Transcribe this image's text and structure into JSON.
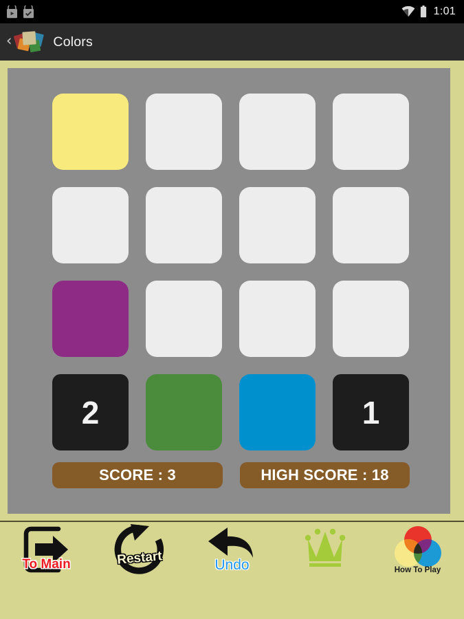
{
  "statusbar": {
    "time": "1:01",
    "icons": [
      "playstore-download-icon",
      "playstore-installed-icon",
      "wifi-icon",
      "battery-icon"
    ]
  },
  "actionbar": {
    "back_glyph": "‹",
    "title": "Colors",
    "logo_name": "colors-app-logo"
  },
  "board": {
    "background_color": "#8c8c8c",
    "page_background_color": "#d6d691",
    "empty_tile_color": "#ededed",
    "grid": [
      [
        {
          "state": "color",
          "color": "#f8ea7c",
          "label": ""
        },
        {
          "state": "empty",
          "color": "#ededed",
          "label": ""
        },
        {
          "state": "empty",
          "color": "#ededed",
          "label": ""
        },
        {
          "state": "empty",
          "color": "#ededed",
          "label": ""
        }
      ],
      [
        {
          "state": "empty",
          "color": "#ededed",
          "label": ""
        },
        {
          "state": "empty",
          "color": "#ededed",
          "label": ""
        },
        {
          "state": "empty",
          "color": "#ededed",
          "label": ""
        },
        {
          "state": "empty",
          "color": "#ededed",
          "label": ""
        }
      ],
      [
        {
          "state": "color",
          "color": "#8e2b84",
          "label": ""
        },
        {
          "state": "empty",
          "color": "#ededed",
          "label": ""
        },
        {
          "state": "empty",
          "color": "#ededed",
          "label": ""
        },
        {
          "state": "empty",
          "color": "#ededed",
          "label": ""
        }
      ],
      [
        {
          "state": "number",
          "color": "#1d1d1d",
          "label": "2"
        },
        {
          "state": "color",
          "color": "#4a8b3c",
          "label": ""
        },
        {
          "state": "color",
          "color": "#0090cd",
          "label": ""
        },
        {
          "state": "number",
          "color": "#1d1d1d",
          "label": "1"
        }
      ]
    ]
  },
  "scores": {
    "bar_color": "#855b28",
    "score_label": "SCORE : 3",
    "high_score_label": "HIGH SCORE : 18"
  },
  "toolbar": {
    "background_color": "#d6d691",
    "buttons": [
      {
        "name": "to-main",
        "label": "To Main",
        "icon": "exit-door-arrow-icon",
        "label_color": "#ee1c24"
      },
      {
        "name": "restart",
        "label": "Restart",
        "icon": "circular-refresh-arrow-icon",
        "label_color": "#fbf8d2"
      },
      {
        "name": "undo",
        "label": "Undo",
        "icon": "back-arrow-icon",
        "label_color": "#2196f3"
      },
      {
        "name": "leaderboard",
        "label": "",
        "icon": "crown-icon",
        "label_color": "#a4cb39"
      },
      {
        "name": "how-to-play",
        "label": "How To Play",
        "icon": "venn-circles-icon",
        "label_color": "#1b1b1b"
      }
    ]
  }
}
